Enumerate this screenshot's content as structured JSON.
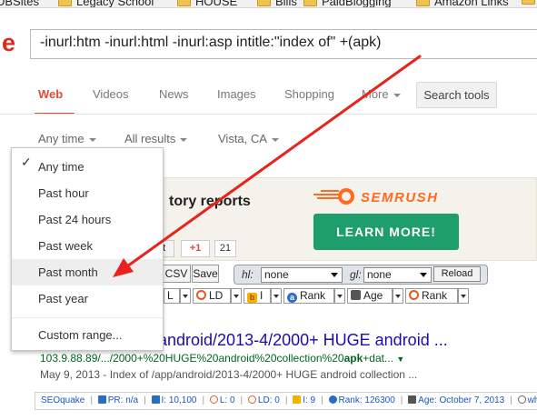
{
  "bookmarks": [
    {
      "label": "DBSites"
    },
    {
      "label": "Legacy School"
    },
    {
      "label": "HOUSE"
    },
    {
      "label": "Bills"
    },
    {
      "label": "PaidBlogging"
    },
    {
      "label": "Amazon Links"
    }
  ],
  "logo_fragment": "e",
  "search": {
    "query": "-inurl:htm -inurl:html -inurl:asp intitle:\"index of\" +(apk)"
  },
  "tabs": {
    "web": "Web",
    "videos": "Videos",
    "news": "News",
    "images": "Images",
    "shopping": "Shopping",
    "more": "More",
    "search_tools": "Search tools"
  },
  "filters": {
    "time": "Any time",
    "results": "All results",
    "location": "Vista, CA"
  },
  "time_menu": {
    "check": "✓",
    "items": [
      "Any time",
      "Past hour",
      "Past 24 hours",
      "Past week",
      "Past month",
      "Past year"
    ],
    "custom": "Custom range..."
  },
  "ad": {
    "title_fragment": "tory reports",
    "brand": "SEMRUSH",
    "cta": "LEARN MORE!",
    "tweet_fragment": "et",
    "gplus": "+1",
    "gplus_count": "21"
  },
  "seoquake": {
    "csv": "CSV",
    "save": "Save",
    "hl_label": "hl:",
    "hl_value": "none",
    "gl_label": "gl:",
    "gl_value": "none",
    "reload": "Reload",
    "row2": {
      "l": "L",
      "ld": "LD",
      "i": "I",
      "rank": "Rank",
      "age": "Age",
      "rank2": "Rank"
    },
    "bottom": {
      "seoquake": "SEOquake",
      "pr": "PR: n/a",
      "i": "I: 10,100",
      "l": "L: 0",
      "ld": "LD: 0",
      "b": "I: 9",
      "rank": "Rank: 126300",
      "age": "Age: October 7, 2013",
      "whois": "wh"
    }
  },
  "result": {
    "title": "android/2013-4/2000+ HUGE android ...",
    "url_prefix": "103.9.88.89/.../2000+%20HUGE%20android%20collection%20",
    "url_bold": "apk",
    "url_suffix": "+dat...",
    "snippet": "May 9, 2013 - Index of /app/android/2013-4/2000+ HUGE android collection ..."
  },
  "colors": {
    "google_red": "#dd4b39",
    "link_blue": "#1a0dab",
    "url_green": "#006621",
    "arrow_red": "#e8231d",
    "semrush_orange": "#ff6b21",
    "learn_more_green": "#1e9e6a"
  }
}
